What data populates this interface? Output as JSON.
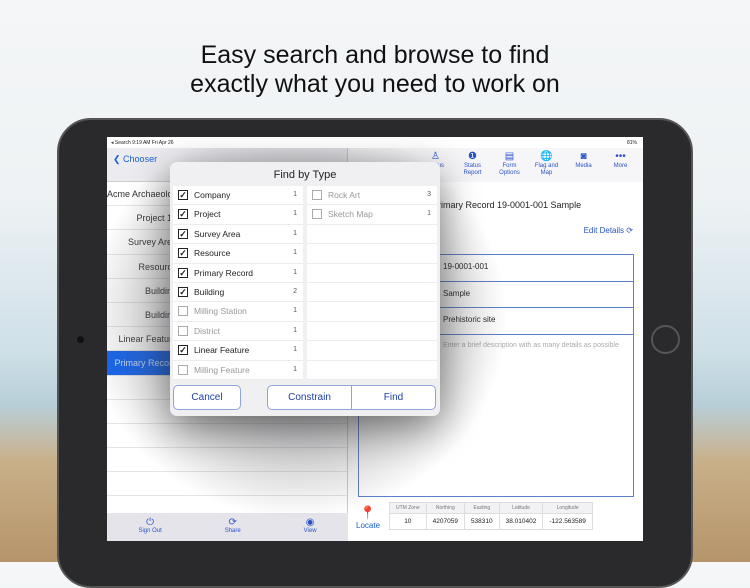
{
  "headline": [
    "Easy search and browse to find",
    "exactly what you need to work on"
  ],
  "status_bar": {
    "left": "◂ Search  9:19 AM  Fri Apr 26",
    "right": "81%"
  },
  "left_panel": {
    "back_label": "Chooser",
    "rows": [
      "Acme Archaeology",
      "Project 19",
      "Survey Area",
      "Resource",
      "Building",
      "Building",
      "Linear Feature",
      "Primary Record",
      "",
      "",
      "",
      "",
      ""
    ],
    "selected_index": 7,
    "toolbar": [
      {
        "icon": "power-icon",
        "glyph": "⏻",
        "label": "Sign Out"
      },
      {
        "icon": "share-icon",
        "glyph": "⟳",
        "label": "Share"
      },
      {
        "icon": "eye-icon",
        "glyph": "◉",
        "label": "View"
      }
    ]
  },
  "right_panel": {
    "toolbar": [
      {
        "icon": "status-icon",
        "glyph": "♙",
        "label": "Status"
      },
      {
        "icon": "status-report-icon",
        "glyph": "❶",
        "label": "Status Report"
      },
      {
        "icon": "form-options-icon",
        "glyph": "▤",
        "label": "Form Options"
      },
      {
        "icon": "globe-icon",
        "glyph": "🌐",
        "label": "Flag and Map"
      },
      {
        "icon": "camera-icon",
        "glyph": "◙",
        "label": "Media"
      },
      {
        "icon": "more-icon",
        "glyph": "•••",
        "label": "More"
      }
    ],
    "title": "Primary Record 19-0001-001 Sample",
    "edit_label": "Edit Details",
    "fields": [
      "19-0001-001",
      "Sample",
      "Prehistoric site"
    ],
    "description_placeholder": "Enter a brief description with as many details as possible",
    "locate_label": "Locate",
    "gps": {
      "headers": [
        "UTM Zone",
        "Northing",
        "Easting",
        "Latitude",
        "Longitude"
      ],
      "values": [
        "10",
        "4207059",
        "538310",
        "38.010402",
        "-122.563589"
      ]
    }
  },
  "popover": {
    "title": "Find by Type",
    "left_items": [
      {
        "label": "Company",
        "count": "1",
        "checked": true
      },
      {
        "label": "Project",
        "count": "1",
        "checked": true
      },
      {
        "label": "Survey Area",
        "count": "1",
        "checked": true
      },
      {
        "label": "Resource",
        "count": "1",
        "checked": true
      },
      {
        "label": "Primary Record",
        "count": "1",
        "checked": true
      },
      {
        "label": "Building",
        "count": "2",
        "checked": true
      },
      {
        "label": "Milling Station",
        "count": "1",
        "checked": false
      },
      {
        "label": "District",
        "count": "1",
        "checked": false
      },
      {
        "label": "Linear Feature",
        "count": "1",
        "checked": true
      },
      {
        "label": "Milling Feature",
        "count": "1",
        "checked": false
      }
    ],
    "right_items": [
      {
        "label": "Rock Art",
        "count": "3",
        "checked": false
      },
      {
        "label": "Sketch Map",
        "count": "1",
        "checked": false
      }
    ],
    "cancel": "Cancel",
    "constrain": "Constrain",
    "find": "Find"
  },
  "colors": {
    "accent": "#1a5fd6",
    "selection": "#1565f0"
  }
}
